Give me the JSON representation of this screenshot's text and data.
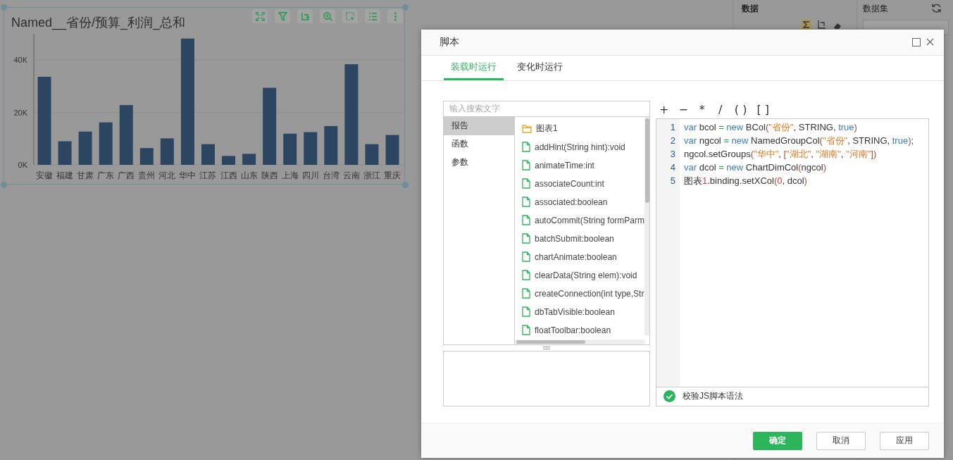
{
  "chart_card": {
    "title": "Named__省份/预算_利润_总和",
    "chart_data": {
      "type": "bar",
      "categories": [
        "安徽",
        "福建",
        "甘肃",
        "广东",
        "广西",
        "贵州",
        "河北",
        "华中",
        "江苏",
        "江西",
        "山东",
        "陕西",
        "上海",
        "四川",
        "台湾",
        "云南",
        "浙江",
        "重庆"
      ],
      "series": [
        {
          "color": "#2c4661",
          "values": [
            33600,
            9000,
            12700,
            16200,
            22800,
            6400,
            10100,
            48200,
            7900,
            3400,
            4200,
            29400,
            11900,
            12500,
            14800,
            38400,
            7900,
            11400
          ]
        }
      ],
      "ylim": [
        0,
        50000
      ],
      "yticks": [
        {
          "value": 0,
          "label": "0K"
        },
        {
          "value": 20000,
          "label": "20K"
        },
        {
          "value": 40000,
          "label": "40K"
        }
      ]
    }
  },
  "data_panel": {
    "title": "数据"
  },
  "dataset_panel": {
    "title": "数据集"
  },
  "dialog": {
    "title": "脚本",
    "tabs": [
      {
        "label": "装载时运行",
        "selected": true
      },
      {
        "label": "变化时运行",
        "selected": false
      }
    ],
    "search": {
      "placeholder": "输入搜索文字"
    },
    "categories": [
      {
        "label": "报告",
        "selected": true
      },
      {
        "label": "函数",
        "selected": false
      },
      {
        "label": "参数",
        "selected": false
      }
    ],
    "items": [
      {
        "kind": "folder",
        "label": "图表1"
      },
      {
        "kind": "member",
        "label": "addHint(String hint):void"
      },
      {
        "kind": "member",
        "label": "animateTime:int"
      },
      {
        "kind": "member",
        "label": "associateCount:int"
      },
      {
        "kind": "member",
        "label": "associated:boolean"
      },
      {
        "kind": "member",
        "label": "autoCommit(String formParm"
      },
      {
        "kind": "member",
        "label": "batchSubmit:boolean"
      },
      {
        "kind": "member",
        "label": "chartAnimate:boolean"
      },
      {
        "kind": "member",
        "label": "clearData(String elem):void"
      },
      {
        "kind": "member",
        "label": "createConnection(int type,Str"
      },
      {
        "kind": "member",
        "label": "dbTabVisible:boolean"
      },
      {
        "kind": "member",
        "label": "floatToolbar:boolean"
      }
    ],
    "operators": [
      "+",
      "−",
      "*",
      "/",
      "( )",
      "[ ]"
    ],
    "code_lines": [
      {
        "number": "1",
        "tokens": [
          {
            "kind": "keyword",
            "text": "var"
          },
          {
            "kind": "plain",
            "text": " bcol "
          },
          {
            "kind": "op",
            "text": "="
          },
          {
            "kind": "keyword",
            "text": " new"
          },
          {
            "kind": "plain",
            "text": " BCol"
          },
          {
            "kind": "paren",
            "text": "("
          },
          {
            "kind": "string",
            "text": "\"省份\""
          },
          {
            "kind": "plain",
            "text": ", STRING, "
          },
          {
            "kind": "keyword",
            "text": "true"
          },
          {
            "kind": "paren",
            "text": ")"
          }
        ]
      },
      {
        "number": "2",
        "tokens": [
          {
            "kind": "keyword",
            "text": "var"
          },
          {
            "kind": "plain",
            "text": " ngcol "
          },
          {
            "kind": "op",
            "text": "="
          },
          {
            "kind": "keyword",
            "text": " new"
          },
          {
            "kind": "plain",
            "text": " NamedGroupCol"
          },
          {
            "kind": "paren",
            "text": "("
          },
          {
            "kind": "string",
            "text": "\"省份\""
          },
          {
            "kind": "plain",
            "text": ", STRING, "
          },
          {
            "kind": "keyword",
            "text": "true"
          },
          {
            "kind": "paren",
            "text": ")"
          },
          {
            "kind": "plain",
            "text": ";"
          }
        ]
      },
      {
        "number": "3",
        "tokens": [
          {
            "kind": "plain",
            "text": "ngcol.setGroups"
          },
          {
            "kind": "paren",
            "text": "("
          },
          {
            "kind": "string",
            "text": "\"华中\""
          },
          {
            "kind": "plain",
            "text": ", "
          },
          {
            "kind": "paren",
            "text": "["
          },
          {
            "kind": "string",
            "text": "\"湖北\""
          },
          {
            "kind": "plain",
            "text": ", "
          },
          {
            "kind": "string",
            "text": "\"湖南\""
          },
          {
            "kind": "plain",
            "text": ", "
          },
          {
            "kind": "string",
            "text": "\"河南\""
          },
          {
            "kind": "paren",
            "text": "]"
          },
          {
            "kind": "paren",
            "text": ")"
          }
        ]
      },
      {
        "number": "4",
        "tokens": [
          {
            "kind": "keyword",
            "text": "var"
          },
          {
            "kind": "plain",
            "text": " dcol "
          },
          {
            "kind": "op",
            "text": "="
          },
          {
            "kind": "keyword",
            "text": " new"
          },
          {
            "kind": "plain",
            "text": " ChartDimCol"
          },
          {
            "kind": "paren",
            "text": "("
          },
          {
            "kind": "plain",
            "text": "ngcol"
          },
          {
            "kind": "paren",
            "text": ")"
          }
        ]
      },
      {
        "number": "5",
        "tokens": [
          {
            "kind": "plain",
            "text": "图表"
          },
          {
            "kind": "number",
            "text": "1"
          },
          {
            "kind": "plain",
            "text": ".binding.setXCol"
          },
          {
            "kind": "paren",
            "text": "("
          },
          {
            "kind": "number",
            "text": "0"
          },
          {
            "kind": "plain",
            "text": ", dcol"
          },
          {
            "kind": "paren",
            "text": ")"
          }
        ]
      }
    ],
    "syntax_check": {
      "label": "校验JS脚本语法"
    },
    "buttons": [
      {
        "label": "确定",
        "kind": "primary"
      },
      {
        "label": "取消",
        "kind": "default"
      },
      {
        "label": "应用",
        "kind": "default"
      }
    ]
  }
}
